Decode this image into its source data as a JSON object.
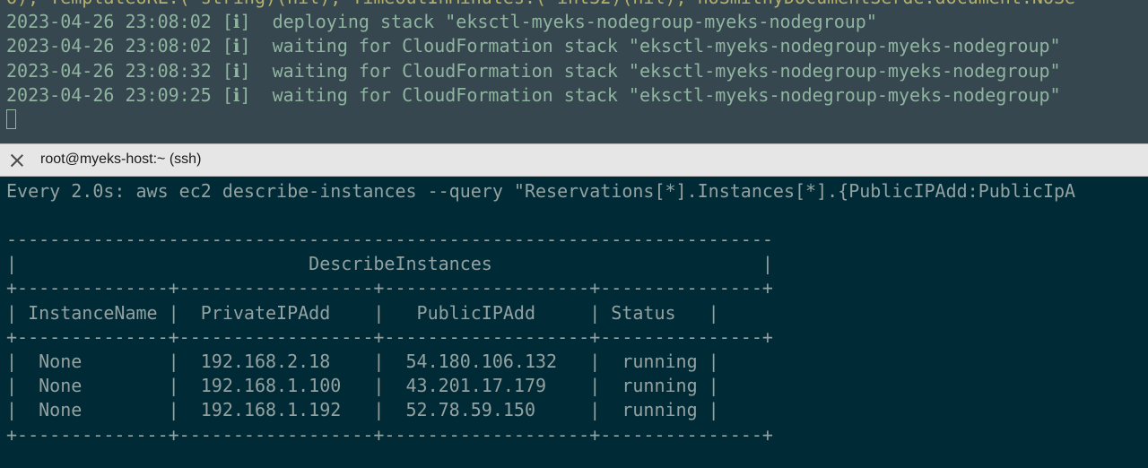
{
  "top_pane": {
    "lines": [
      "o), TemplateURL:(*string)(nil), TimeoutInMinutes:(*int32)(nil), noSmithyDocumentSerde:document.NoSe",
      "2023-04-26 23:08:02 [ℹ]  deploying stack \"eksctl-myeks-nodegroup-myeks-nodegroup\"",
      "2023-04-26 23:08:02 [ℹ]  waiting for CloudFormation stack \"eksctl-myeks-nodegroup-myeks-nodegroup\"",
      "2023-04-26 23:08:32 [ℹ]  waiting for CloudFormation stack \"eksctl-myeks-nodegroup-myeks-nodegroup\"",
      "2023-04-26 23:09:25 [ℹ]  waiting for CloudFormation stack \"eksctl-myeks-nodegroup-myeks-nodegroup\""
    ]
  },
  "tab": {
    "title": "root@myeks-host:~ (ssh)"
  },
  "bottom_pane": {
    "watch_header": "Every 2.0s: aws ec2 describe-instances --query \"Reservations[*].Instances[*].{PublicIPAdd:PublicIpA",
    "table_lines": [
      "-----------------------------------------------------------------------",
      "|                           DescribeInstances                         |",
      "+--------------+------------------+-------------------+---------------+",
      "| InstanceName |  PrivateIPAdd    |   PublicIPAdd     | Status   |",
      "+--------------+------------------+-------------------+---------------+",
      "|  None        |  192.168.2.18    |  54.180.106.132   |  running |",
      "|  None        |  192.168.1.100   |  43.201.17.179    |  running |",
      "|  None        |  192.168.1.192   |  52.78.59.150     |  running |",
      "+--------------+------------------+-------------------+---------------+"
    ]
  }
}
